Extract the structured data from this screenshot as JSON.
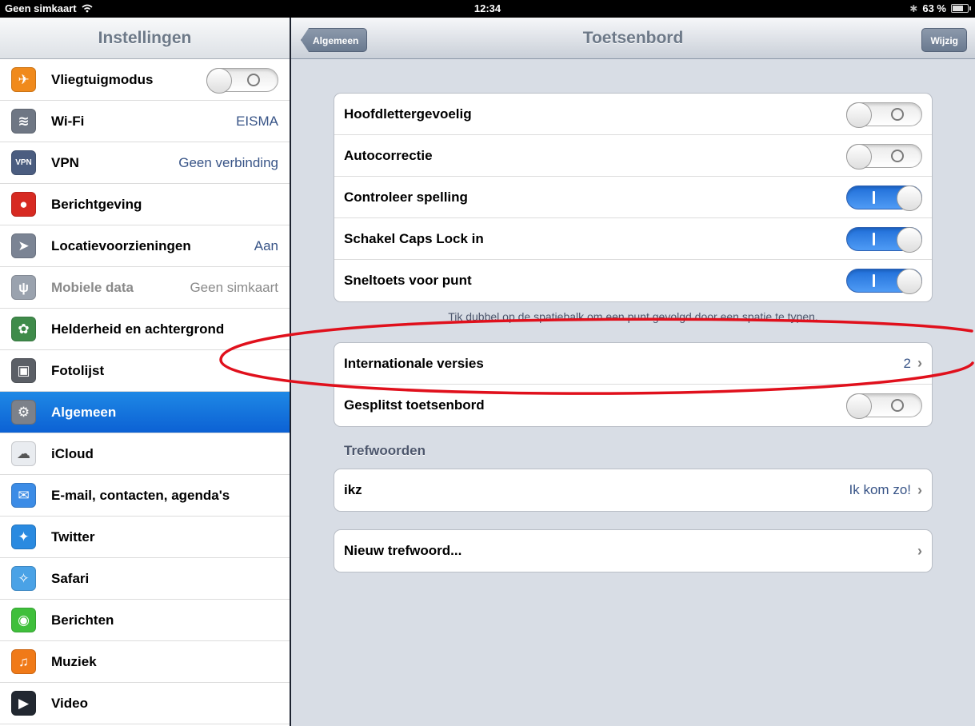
{
  "status_bar": {
    "carrier": "Geen simkaart",
    "time": "12:34",
    "battery": "63 %",
    "battery_level": 0.63
  },
  "sidebar": {
    "title": "Instellingen",
    "items": [
      {
        "label": "Vliegtuigmodus",
        "icon": "airplane-icon",
        "icon_color": "#f08a1c",
        "toggle": false
      },
      {
        "label": "Wi-Fi",
        "value": "EISMA",
        "icon": "wifi-icon",
        "icon_color": "#6f7784"
      },
      {
        "label": "VPN",
        "value": "Geen verbinding",
        "icon": "vpn-icon",
        "icon_color": "#4b5d80"
      },
      {
        "label": "Berichtgeving",
        "icon": "notifications-icon",
        "icon_color": "#d72a22"
      },
      {
        "label": "Locatievoorzieningen",
        "value": "Aan",
        "icon": "location-icon",
        "icon_color": "#7b8494"
      },
      {
        "label": "Mobiele data",
        "value": "Geen simkaart",
        "icon": "cellular-icon",
        "icon_color": "#9aa2ae",
        "disabled": true
      },
      {
        "label": "Helderheid en achtergrond",
        "icon": "wallpaper-icon",
        "icon_color": "#3f8b4a"
      },
      {
        "label": "Fotolijst",
        "icon": "picture-frame-icon",
        "icon_color": "#5b5f66"
      },
      {
        "label": "Algemeen",
        "icon": "gear-icon",
        "icon_color": "#7c818a",
        "selected": true
      },
      {
        "label": "iCloud",
        "icon": "cloud-icon",
        "icon_color": "#e9ecf0"
      },
      {
        "label": "E-mail, contacten, agenda's",
        "icon": "mail-icon",
        "icon_color": "#3c8ce6"
      },
      {
        "label": "Twitter",
        "icon": "twitter-icon",
        "icon_color": "#2a8ae0"
      },
      {
        "label": "Safari",
        "icon": "compass-icon",
        "icon_color": "#4aa2e6"
      },
      {
        "label": "Berichten",
        "icon": "messages-icon",
        "icon_color": "#3fbf3b"
      },
      {
        "label": "Muziek",
        "icon": "music-icon",
        "icon_color": "#f07a18"
      },
      {
        "label": "Video",
        "icon": "video-icon",
        "icon_color": "#222831"
      }
    ]
  },
  "navbar": {
    "back_label": "Algemeen",
    "title": "Toetsenbord",
    "edit_label": "Wijzig"
  },
  "keyboard_group": [
    {
      "label": "Hoofdlettergevoelig",
      "toggle": false
    },
    {
      "label": "Autocorrectie",
      "toggle": false
    },
    {
      "label": "Controleer spelling",
      "toggle": true
    },
    {
      "label": "Schakel Caps Lock in",
      "toggle": true
    },
    {
      "label": "Sneltoets voor punt",
      "toggle": true
    }
  ],
  "footnote": "Tik dubbel op de spatiebalk om een punt gevolgd door een spatie te typen.",
  "intl_group": [
    {
      "label": "Internationale versies",
      "value": "2"
    },
    {
      "label": "Gesplitst toetsenbord",
      "toggle": false
    }
  ],
  "shortcuts": {
    "section_title": "Trefwoorden",
    "items": [
      {
        "label": "ikz",
        "value": "Ik kom zo!"
      }
    ],
    "add_label": "Nieuw trefwoord..."
  },
  "annotation": {
    "color": "#e0101c"
  }
}
